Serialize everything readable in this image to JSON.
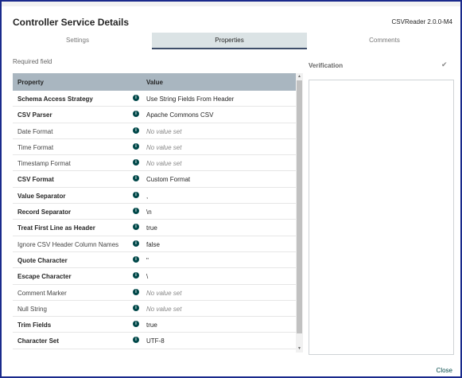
{
  "dialog": {
    "title": "Controller Service Details",
    "version": "CSVReader 2.0.0-M4",
    "close_label": "Close"
  },
  "tabs": [
    {
      "label": "Settings",
      "active": false
    },
    {
      "label": "Properties",
      "active": true
    },
    {
      "label": "Comments",
      "active": false
    }
  ],
  "required_field_label": "Required field",
  "table": {
    "headers": {
      "property": "Property",
      "value": "Value"
    },
    "info_icon": "info-circle-icon",
    "rows": [
      {
        "name": "Schema Access Strategy",
        "value": "Use String Fields From Header",
        "required": true,
        "empty": false
      },
      {
        "name": "CSV Parser",
        "value": "Apache Commons CSV",
        "required": true,
        "empty": false
      },
      {
        "name": "Date Format",
        "value": "No value set",
        "required": false,
        "empty": true
      },
      {
        "name": "Time Format",
        "value": "No value set",
        "required": false,
        "empty": true
      },
      {
        "name": "Timestamp Format",
        "value": "No value set",
        "required": false,
        "empty": true
      },
      {
        "name": "CSV Format",
        "value": "Custom Format",
        "required": true,
        "empty": false
      },
      {
        "name": "Value Separator",
        "value": ",",
        "required": true,
        "empty": false
      },
      {
        "name": "Record Separator",
        "value": "\\n",
        "required": true,
        "empty": false
      },
      {
        "name": "Treat First Line as Header",
        "value": "true",
        "required": true,
        "empty": false
      },
      {
        "name": "Ignore CSV Header Column Names",
        "value": "false",
        "required": false,
        "empty": false
      },
      {
        "name": "Quote Character",
        "value": "\"",
        "required": true,
        "empty": false
      },
      {
        "name": "Escape Character",
        "value": "\\",
        "required": true,
        "empty": false
      },
      {
        "name": "Comment Marker",
        "value": "No value set",
        "required": false,
        "empty": true
      },
      {
        "name": "Null String",
        "value": "No value set",
        "required": false,
        "empty": true
      },
      {
        "name": "Trim Fields",
        "value": "true",
        "required": true,
        "empty": false
      },
      {
        "name": "Character Set",
        "value": "UTF-8",
        "required": true,
        "empty": false
      }
    ]
  },
  "verification": {
    "label": "Verification",
    "icon": "check-icon"
  },
  "colors": {
    "header_bg": "#a9b6c0",
    "active_tab_bg": "#dbe3e5",
    "info_icon": "#004849",
    "frame_border": "#1a2a8c"
  }
}
